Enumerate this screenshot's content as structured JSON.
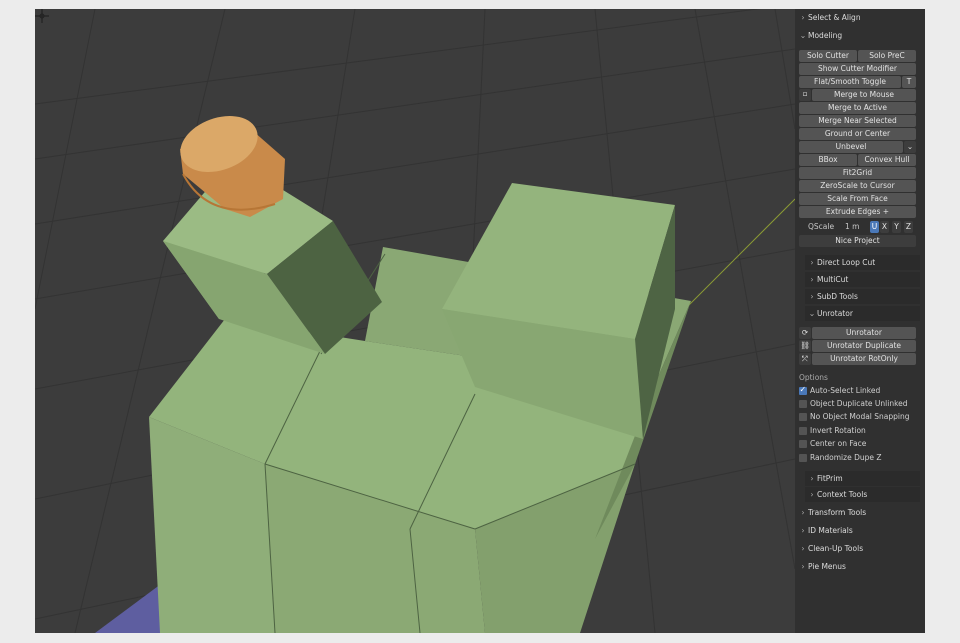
{
  "panel": {
    "sections": {
      "select_align": "Select & Align",
      "modeling": "Modeling",
      "transform_tools": "Transform Tools",
      "id_materials": "ID Materials",
      "clean_up_tools": "Clean-Up Tools",
      "pie_menus": "Pie Menus"
    },
    "modeling": {
      "solo_cutter": "Solo Cutter",
      "solo_prec": "Solo PreC",
      "show_cutter_modifier": "Show Cutter Modifier",
      "flat_smooth_toggle": "Flat/Smooth Toggle",
      "t_button": "T",
      "merge_to_mouse": "Merge to Mouse",
      "merge_to_active": "Merge to Active",
      "merge_near_selected": "Merge Near Selected",
      "ground_or_center": "Ground or Center",
      "unbevel": "Unbevel",
      "bbox": "BBox",
      "convex_hull": "Convex Hull",
      "fit2grid": "Fit2Grid",
      "zeroscale_to_cursor": "ZeroScale to Cursor",
      "scale_from_face": "Scale From Face",
      "extrude_edges": "Extrude Edges +",
      "qscale_label": "QScale",
      "qscale_value": "1 m",
      "axes": [
        "U",
        "X",
        "Y",
        "Z"
      ],
      "nice_project": "Nice Project"
    },
    "subsections": {
      "direct_loop_cut": "Direct Loop Cut",
      "multicut": "MultiCut",
      "subd_tools": "SubD Tools",
      "unrotator": "Unrotator",
      "fitprim": "FitPrim",
      "context_tools": "Context Tools"
    },
    "unrotator": {
      "unrotator": "Unrotator",
      "unrotator_duplicate": "Unrotator Duplicate",
      "unrotator_rotonly": "Unrotator RotOnly"
    },
    "options": {
      "title": "Options",
      "items": [
        {
          "label": "Auto-Select Linked",
          "checked": true
        },
        {
          "label": "Object Duplicate Unlinked",
          "checked": false
        },
        {
          "label": "No Object Modal Snapping",
          "checked": false
        },
        {
          "label": "Invert Rotation",
          "checked": false
        },
        {
          "label": "Center on Face",
          "checked": false
        },
        {
          "label": "Randomize Dupe Z",
          "checked": false
        }
      ]
    }
  },
  "colors": {
    "viewport_bg": "#3c3c3c",
    "mesh_green": "#93b47c",
    "cylinder_orange": "#d08a45",
    "accent_blue": "#4a78b8"
  }
}
